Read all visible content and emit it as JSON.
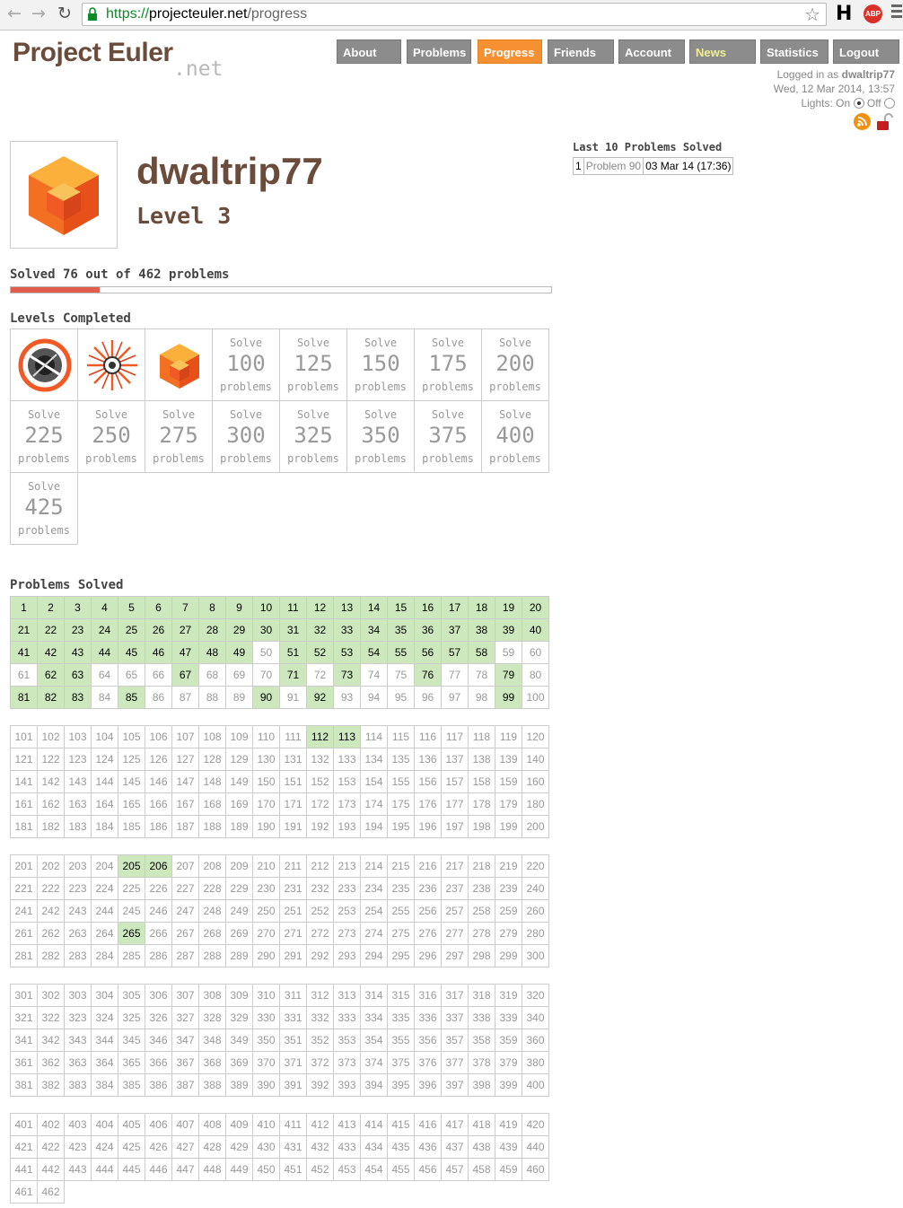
{
  "browser": {
    "url_scheme": "https://",
    "url_host": "projecteuler.net",
    "url_path": "/progress",
    "nav_icons": [
      "back-arrow-icon",
      "forward-arrow-icon",
      "reload-icon"
    ],
    "extensions": {
      "h_label": "H",
      "abp_label": "ABP"
    }
  },
  "site": {
    "logo_main": "Project Euler",
    "logo_sub": ".net"
  },
  "nav": [
    {
      "label": "About"
    },
    {
      "label": "Problems"
    },
    {
      "label": "Progress"
    },
    {
      "label": "Friends"
    },
    {
      "label": "Account"
    },
    {
      "label": "News"
    },
    {
      "label": "Statistics"
    },
    {
      "label": "Logout"
    }
  ],
  "info": {
    "logged_in_prefix": "Logged in as ",
    "user": "dwaltrip77",
    "datetime": "Wed, 12 Mar 2014, 13:57",
    "lights_label": "Lights: On",
    "lights_off": "Off",
    "lights_state": "On"
  },
  "profile": {
    "username": "dwaltrip77",
    "level": "Level 3"
  },
  "progress": {
    "heading": "Solved 76 out of 462 problems",
    "solved": 76,
    "total": 462
  },
  "last_solved": {
    "heading": "Last 10 Problems Solved",
    "rows": [
      {
        "n": "1",
        "problem": "Problem 90",
        "date": "03 Mar 14 (17:36)"
      }
    ]
  },
  "levels": {
    "heading": "Levels Completed",
    "completed_icons": [
      "target-icon",
      "starburst-icon",
      "cube-icon"
    ],
    "pending": [
      {
        "pre": "Solve",
        "num": "100",
        "post": "problems"
      },
      {
        "pre": "Solve",
        "num": "125",
        "post": "problems"
      },
      {
        "pre": "Solve",
        "num": "150",
        "post": "problems"
      },
      {
        "pre": "Solve",
        "num": "175",
        "post": "problems"
      },
      {
        "pre": "Solve",
        "num": "200",
        "post": "problems"
      },
      {
        "pre": "Solve",
        "num": "225",
        "post": "problems"
      },
      {
        "pre": "Solve",
        "num": "250",
        "post": "problems"
      },
      {
        "pre": "Solve",
        "num": "275",
        "post": "problems"
      },
      {
        "pre": "Solve",
        "num": "300",
        "post": "problems"
      },
      {
        "pre": "Solve",
        "num": "325",
        "post": "problems"
      },
      {
        "pre": "Solve",
        "num": "350",
        "post": "problems"
      },
      {
        "pre": "Solve",
        "num": "375",
        "post": "problems"
      },
      {
        "pre": "Solve",
        "num": "400",
        "post": "problems"
      },
      {
        "pre": "Solve",
        "num": "425",
        "post": "problems"
      }
    ]
  },
  "problems_solved": {
    "heading": "Problems Solved",
    "total": 462,
    "solved": [
      1,
      2,
      3,
      4,
      5,
      6,
      7,
      8,
      9,
      10,
      11,
      12,
      13,
      14,
      15,
      16,
      17,
      18,
      19,
      20,
      21,
      22,
      23,
      24,
      25,
      26,
      27,
      28,
      29,
      30,
      31,
      32,
      33,
      34,
      35,
      36,
      37,
      38,
      39,
      40,
      41,
      42,
      43,
      44,
      45,
      46,
      47,
      48,
      49,
      51,
      52,
      53,
      54,
      55,
      56,
      57,
      58,
      62,
      63,
      67,
      71,
      73,
      76,
      79,
      81,
      82,
      83,
      85,
      90,
      92,
      99,
      112,
      113,
      205,
      206,
      265
    ],
    "colors": {
      "solved_bg": "#cde8bd",
      "accent": "#f69133",
      "bar": "#e25d4b"
    }
  }
}
